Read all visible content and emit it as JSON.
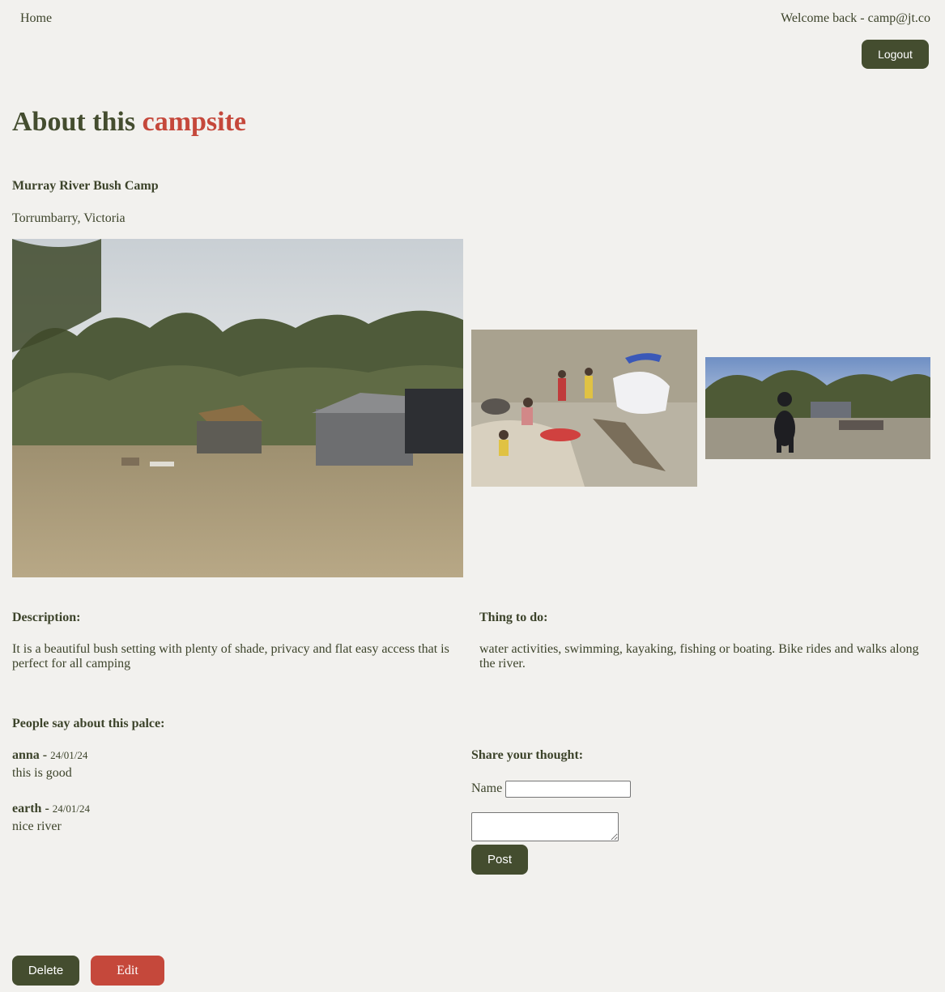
{
  "nav": {
    "home_label": "Home",
    "welcome_text": "Welcome back - camp@jt.co",
    "logout_label": "Logout"
  },
  "page": {
    "title_part1": "About this ",
    "title_part2": "campsite"
  },
  "campsite": {
    "name": "Murray River Bush Camp",
    "location": "Torrumbarry, Victoria",
    "description_heading": "Description:",
    "description": "It is a beautiful bush setting with plenty of shade, privacy and flat easy access that is perfect for all camping",
    "todo_heading": "Thing to do:",
    "todo": "water activities, swimming, kayaking, fishing or boating. Bike rides and walks along the river."
  },
  "reviews": {
    "heading": "People say about this palce:",
    "items": [
      {
        "author": "anna",
        "separator": " - ",
        "date": "24/01/24",
        "comment": "this is good"
      },
      {
        "author": "earth",
        "separator": " - ",
        "date": "24/01/24",
        "comment": "nice river"
      }
    ]
  },
  "share": {
    "heading": "Share your thought:",
    "name_label": "Name",
    "name_value": "",
    "comment_value": "",
    "post_label": "Post"
  },
  "actions": {
    "delete_label": "Delete",
    "edit_label": "Edit"
  },
  "colors": {
    "brand_green": "#444d2f",
    "accent_red": "#c5483b",
    "background": "#f2f1ee"
  }
}
